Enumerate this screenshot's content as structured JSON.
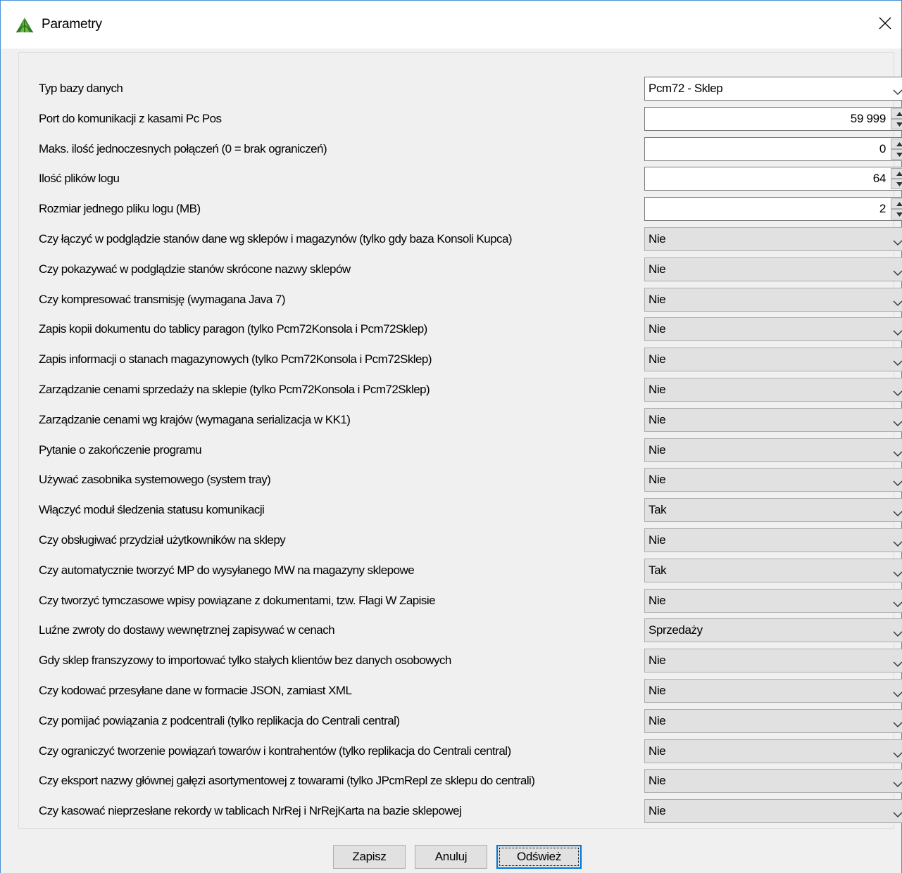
{
  "window": {
    "title": "Parametry",
    "app_icon": "green-leaf-icon",
    "close_icon": "close-icon"
  },
  "params": [
    {
      "label": "Typ bazy danych",
      "control": "combo",
      "value": "Pcm72 - Sklep",
      "editable": true
    },
    {
      "label": "Port do komunikacji z kasami Pc Pos",
      "control": "spinner",
      "value": "59 999"
    },
    {
      "label": "Maks. ilość jednoczesnych połączeń (0 = brak ograniczeń)",
      "control": "spinner",
      "value": "0"
    },
    {
      "label": "Ilość plików logu",
      "control": "spinner",
      "value": "64"
    },
    {
      "label": "Rozmiar jednego pliku logu (MB)",
      "control": "spinner",
      "value": "2"
    },
    {
      "label": "Czy łączyć w podglądzie stanów dane wg sklepów i magazynów (tylko gdy baza Konsoli Kupca)",
      "control": "combo",
      "value": "Nie"
    },
    {
      "label": "Czy pokazywać w podglądzie stanów skrócone nazwy sklepów",
      "control": "combo",
      "value": "Nie"
    },
    {
      "label": "Czy kompresować transmisję (wymagana Java 7)",
      "control": "combo",
      "value": "Nie"
    },
    {
      "label": "Zapis kopii dokumentu do tablicy paragon (tylko Pcm72Konsola i Pcm72Sklep)",
      "control": "combo",
      "value": "Nie"
    },
    {
      "label": "Zapis informacji o stanach magazynowych (tylko Pcm72Konsola i Pcm72Sklep)",
      "control": "combo",
      "value": "Nie"
    },
    {
      "label": "Zarządzanie cenami sprzedaży na sklepie (tylko Pcm72Konsola i Pcm72Sklep)",
      "control": "combo",
      "value": "Nie"
    },
    {
      "label": "Zarządzanie cenami wg krajów (wymagana serializacja w KK1)",
      "control": "combo",
      "value": "Nie"
    },
    {
      "label": "Pytanie o zakończenie programu",
      "control": "combo",
      "value": "Nie"
    },
    {
      "label": "Używać zasobnika systemowego (system tray)",
      "control": "combo",
      "value": "Nie"
    },
    {
      "label": "Włączyć moduł śledzenia statusu komunikacji",
      "control": "combo",
      "value": "Tak"
    },
    {
      "label": "Czy obsługiwać przydział użytkowników na sklepy",
      "control": "combo",
      "value": "Nie"
    },
    {
      "label": "Czy automatycznie tworzyć MP do wysyłanego MW na magazyny sklepowe",
      "control": "combo",
      "value": "Tak"
    },
    {
      "label": "Czy tworzyć tymczasowe wpisy powiązane z dokumentami, tzw. Flagi W Zapisie",
      "control": "combo",
      "value": "Nie"
    },
    {
      "label": "Luźne zwroty do dostawy wewnętrznej zapisywać w cenach",
      "control": "combo",
      "value": "Sprzedaży"
    },
    {
      "label": "Gdy sklep franszyzowy to importować tylko stałych klientów bez danych osobowych",
      "control": "combo",
      "value": "Nie"
    },
    {
      "label": "Czy kodować przesyłane dane w formacie JSON, zamiast XML",
      "control": "combo",
      "value": "Nie"
    },
    {
      "label": "Czy pomijać powiązania z podcentrali (tylko replikacja do Centrali central)",
      "control": "combo",
      "value": "Nie"
    },
    {
      "label": "Czy ograniczyć tworzenie powiązań towarów i kontrahentów (tylko replikacja do Centrali central)",
      "control": "combo",
      "value": "Nie"
    },
    {
      "label": "Czy eksport nazwy głównej gałęzi asortymentowej z towarami (tylko JPcmRepl ze sklepu do centrali)",
      "control": "combo",
      "value": "Nie"
    },
    {
      "label": "Czy kasować nieprzesłane rekordy w tablicach NrRej i NrRejKarta na bazie sklepowej",
      "control": "combo",
      "value": "Nie"
    }
  ],
  "buttons": {
    "save": "Zapisz",
    "cancel": "Anuluj",
    "refresh": "Odśwież"
  },
  "colors": {
    "title_bar": "#ffffff",
    "window_border": "#4a8fd6",
    "background": "#f0f0f0",
    "control_face": "#e1e1e1",
    "focus": "#0078d7",
    "icon_green": "#3a8a2a"
  }
}
